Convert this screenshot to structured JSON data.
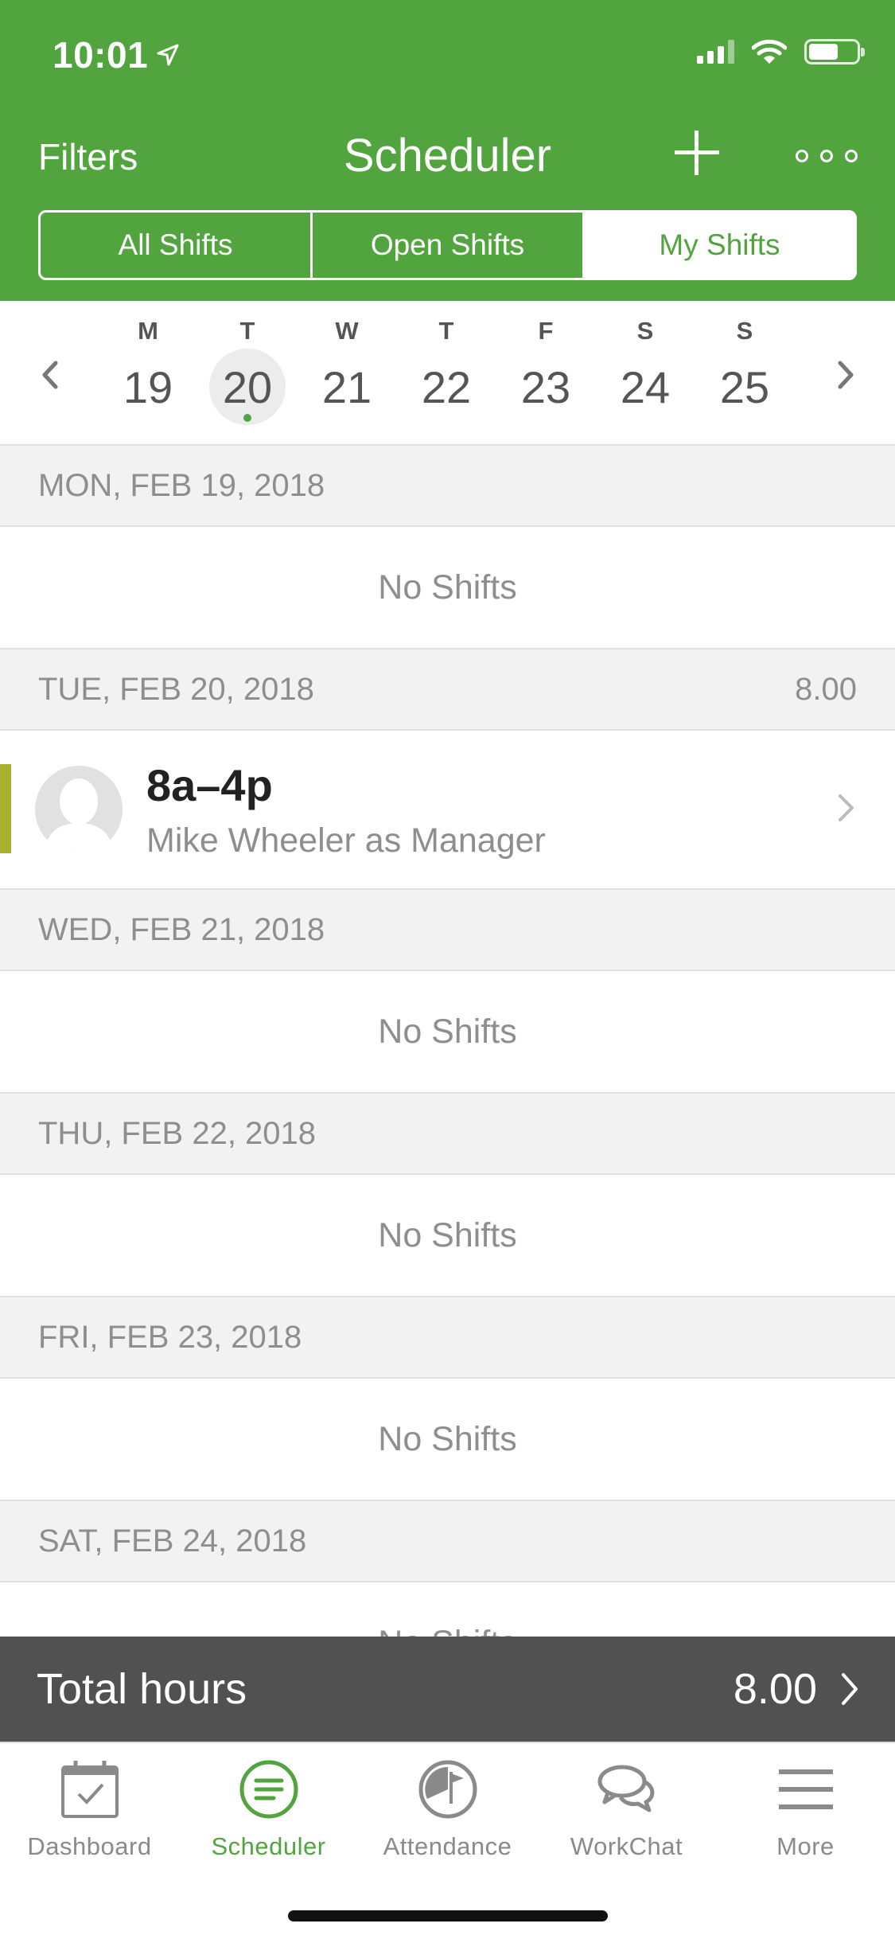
{
  "status_bar": {
    "time": "10:01"
  },
  "header": {
    "filters_label": "Filters",
    "title": "Scheduler",
    "add_icon": "plus-icon",
    "more_icon": "ellipsis-icon",
    "tabs": [
      {
        "label": "All Shifts",
        "selected": false
      },
      {
        "label": "Open Shifts",
        "selected": false
      },
      {
        "label": "My Shifts",
        "selected": true
      }
    ]
  },
  "week": {
    "days": [
      {
        "letter": "M",
        "number": "19"
      },
      {
        "letter": "T",
        "number": "20",
        "selected": true
      },
      {
        "letter": "W",
        "number": "21"
      },
      {
        "letter": "T",
        "number": "22"
      },
      {
        "letter": "F",
        "number": "23"
      },
      {
        "letter": "S",
        "number": "24"
      },
      {
        "letter": "S",
        "number": "25"
      }
    ]
  },
  "sections": [
    {
      "date": "MON, FEB 19, 2018",
      "hours": "",
      "empty_text": "No Shifts"
    },
    {
      "date": "TUE, FEB 20, 2018",
      "hours": "8.00",
      "shift": {
        "time": "8a–4p",
        "who": "Mike Wheeler as Manager",
        "color": "#a9b12c"
      }
    },
    {
      "date": "WED, FEB 21, 2018",
      "hours": "",
      "empty_text": "No Shifts"
    },
    {
      "date": "THU, FEB 22, 2018",
      "hours": "",
      "empty_text": "No Shifts"
    },
    {
      "date": "FRI, FEB 23, 2018",
      "hours": "",
      "empty_text": "No Shifts"
    },
    {
      "date": "SAT, FEB 24, 2018",
      "hours": "",
      "empty_text": "No Shifts"
    }
  ],
  "total": {
    "label": "Total hours",
    "value": "8.00"
  },
  "tabbar": {
    "items": [
      {
        "label": "Dashboard",
        "icon": "calendar-check-icon"
      },
      {
        "label": "Scheduler",
        "icon": "scheduler-icon",
        "active": true
      },
      {
        "label": "Attendance",
        "icon": "clock-flag-icon"
      },
      {
        "label": "WorkChat",
        "icon": "chat-bubbles-icon"
      },
      {
        "label": "More",
        "icon": "hamburger-icon"
      }
    ]
  },
  "colors": {
    "brand_green": "#52a43e",
    "shift_accent": "#a9b12c",
    "total_bar": "#515151"
  }
}
